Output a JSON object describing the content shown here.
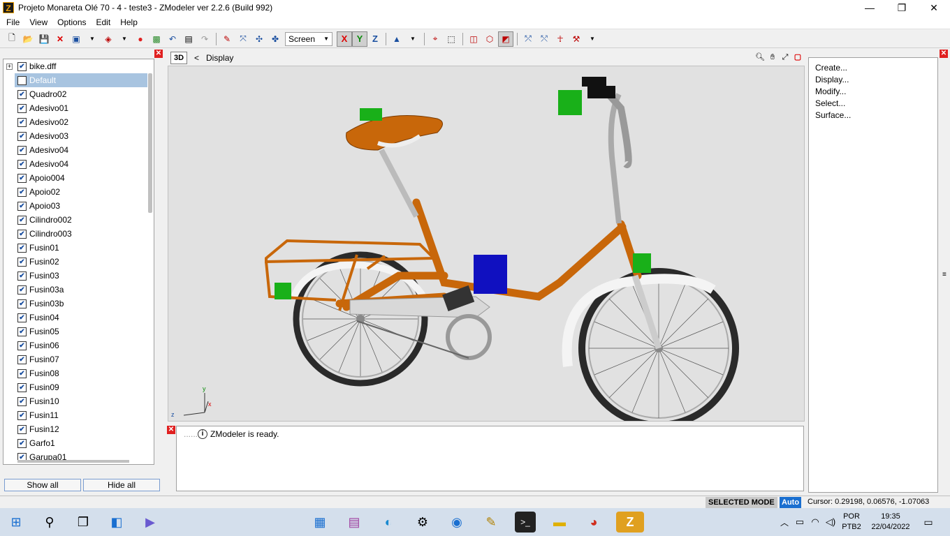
{
  "window": {
    "title": "Projeto Monareta Olé 70 - 4 - teste3 - ZModeler ver 2.2.6 (Build 992)",
    "app_icon_letter": "Z",
    "minimize": "—",
    "maximize": "❐",
    "close": "✕"
  },
  "menu": [
    "File",
    "View",
    "Options",
    "Edit",
    "Help"
  ],
  "toolbar": {
    "view_select": "Screen",
    "axes": [
      "X",
      "Y",
      "Z"
    ],
    "active_axes": [
      "X",
      "Y"
    ]
  },
  "tree": {
    "root": "bike.dff",
    "items": [
      {
        "label": "Default",
        "checked": false,
        "selected": true
      },
      {
        "label": "Quadro02",
        "checked": true
      },
      {
        "label": "Adesivo01",
        "checked": true
      },
      {
        "label": "Adesivo02",
        "checked": true
      },
      {
        "label": "Adesivo03",
        "checked": true
      },
      {
        "label": "Adesivo04",
        "checked": true
      },
      {
        "label": "Adesivo04",
        "checked": true
      },
      {
        "label": "Apoio004",
        "checked": true
      },
      {
        "label": "Apoio02",
        "checked": true
      },
      {
        "label": "Apoio03",
        "checked": true
      },
      {
        "label": "Cilindro002",
        "checked": true
      },
      {
        "label": "Cilindro003",
        "checked": true
      },
      {
        "label": "Fusin01",
        "checked": true
      },
      {
        "label": "Fusin02",
        "checked": true
      },
      {
        "label": "Fusin03",
        "checked": true
      },
      {
        "label": "Fusin03a",
        "checked": true
      },
      {
        "label": "Fusin03b",
        "checked": true
      },
      {
        "label": "Fusin04",
        "checked": true
      },
      {
        "label": "Fusin05",
        "checked": true
      },
      {
        "label": "Fusin06",
        "checked": true
      },
      {
        "label": "Fusin07",
        "checked": true
      },
      {
        "label": "Fusin08",
        "checked": true
      },
      {
        "label": "Fusin09",
        "checked": true
      },
      {
        "label": "Fusin10",
        "checked": true
      },
      {
        "label": "Fusin11",
        "checked": true
      },
      {
        "label": "Fusin12",
        "checked": true
      },
      {
        "label": "Garfo1",
        "checked": true
      },
      {
        "label": "Garupa01",
        "checked": true
      }
    ],
    "show_all": "Show all",
    "hide_all": "Hide all"
  },
  "viewport": {
    "mode_label": "3D",
    "arrow": "<",
    "name": "Display",
    "axis_labels": {
      "y": "y",
      "z": "z",
      "x": "x"
    }
  },
  "log": {
    "prefix": "......",
    "message": "ZModeler is ready."
  },
  "commands": [
    "Create...",
    "Display...",
    "Modify...",
    "Select...",
    "Surface..."
  ],
  "status": {
    "mode": "SELECTED MODE",
    "auto": "Auto",
    "cursor": "Cursor: 0.29198, 0.06576, -1.07063"
  },
  "taskbar": {
    "language": "POR",
    "layout": "PTB2",
    "time": "19:35",
    "date": "22/04/2022"
  },
  "colors": {
    "frame_orange": "#c8670a",
    "marker_green": "#19b019",
    "marker_blue": "#1010c0",
    "viewport_bg": "#e1e1e1"
  }
}
